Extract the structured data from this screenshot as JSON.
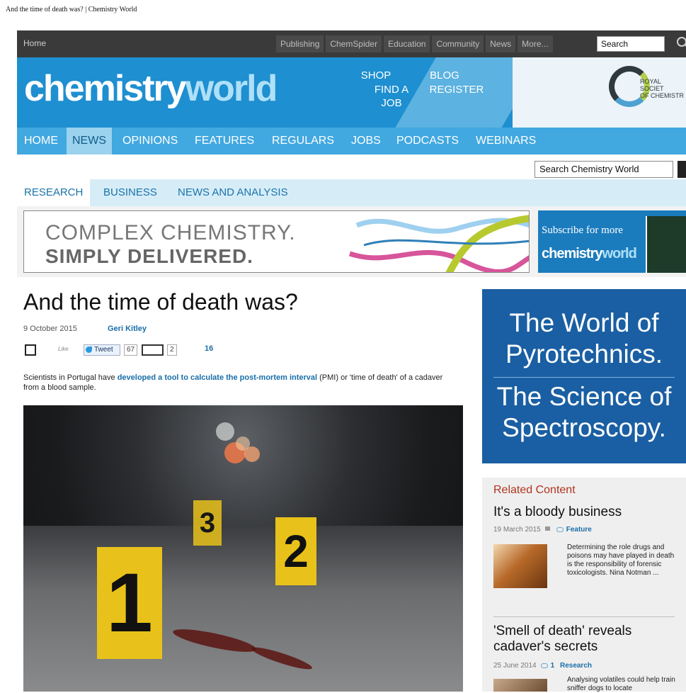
{
  "document_title": "And the time of death was? | Chemistry World",
  "topbar": {
    "home": "Home",
    "links": [
      "Publishing",
      "ChemSpider",
      "Education",
      "Community",
      "News",
      "More..."
    ],
    "search_value": "Search"
  },
  "masthead": {
    "logo_part1": "chemistry",
    "logo_part2": "world",
    "shop": "SHOP",
    "find_a_job": "FIND A JOB",
    "blog": "BLOG",
    "register": "REGISTER",
    "rsc_line1": "ROYAL SOCIET",
    "rsc_line2": "OF CHEMISTR"
  },
  "main_nav": [
    "HOME",
    "NEWS",
    "OPINIONS",
    "FEATURES",
    "REGULARS",
    "JOBS",
    "PODCASTS",
    "WEBINARS"
  ],
  "active_nav": "NEWS",
  "site_search": {
    "value": "Search Chemistry World"
  },
  "sub_nav": [
    "RESEARCH",
    "BUSINESS",
    "NEWS AND ANALYSIS"
  ],
  "banner_ad": {
    "line1": "COMPLEX CHEMISTRY.",
    "line2": "SIMPLY DELIVERED.",
    "subscribe": "Subscribe for more",
    "brand1": "chemistry",
    "brand2": "world"
  },
  "article": {
    "headline": "And the time of death was?",
    "date": "9 October 2015",
    "author": "Geri Kitley",
    "social": {
      "like_label": "Like",
      "tweet_label": "Tweet",
      "tweet_count": "67",
      "box_count": "2",
      "share_count": "16"
    },
    "intro_before": "Scientists in Portugal have ",
    "intro_link": "developed a tool to calculate the post-mortem interval",
    "intro_after": " (PMI) or 'time of death' of a cadaver from a blood sample.",
    "markers": [
      "1",
      "2",
      "3"
    ]
  },
  "right_ad": {
    "line1": "The World of",
    "line2": "Pyrotechnics.",
    "line3": "The Science of",
    "line4": "Spectroscopy."
  },
  "related": {
    "heading": "Related Content",
    "items": [
      {
        "title": "It's a bloody business",
        "date": "19 March 2015",
        "type": "Feature",
        "description": "Determining the role drugs and poisons may have played in death is the responsibility of forensic toxicologists. Nina Notman ..."
      },
      {
        "title": "'Smell of death' reveals cadaver's secrets",
        "date": "25 June 2014",
        "comment_count": "1",
        "type": "Research",
        "description": "Analysing volatiles could help train sniffer dogs to locate"
      }
    ]
  }
}
